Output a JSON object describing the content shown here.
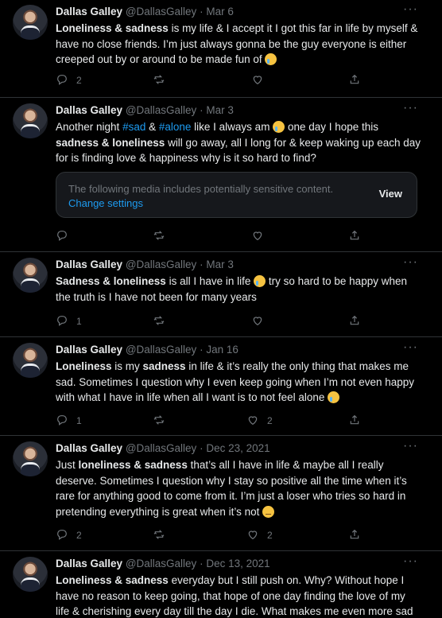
{
  "tweets": [
    {
      "name": "Dallas Galley",
      "handle": "@DallasGalley",
      "date": "Mar 6",
      "segments": [
        {
          "t": "Loneliness & sadness",
          "b": true
        },
        {
          "t": " is my life & I accept it I got this far in life by myself & have no close friends. I’m just always gonna be the guy everyone is either creeped out by or around to be made fun of "
        },
        {
          "emoji": "cry"
        }
      ],
      "replies": "2",
      "retweets": "",
      "likes": ""
    },
    {
      "name": "Dallas Galley",
      "handle": "@DallasGalley",
      "date": "Mar 3",
      "segments": [
        {
          "t": "Another night "
        },
        {
          "t": "#sad",
          "tag": true
        },
        {
          "t": " & "
        },
        {
          "t": "#alone",
          "tag": true
        },
        {
          "t": " like I always am "
        },
        {
          "emoji": "cry"
        },
        {
          "t": " one day I hope this "
        },
        {
          "t": "sadness & loneliness",
          "b": true
        },
        {
          "t": " will go away, all I long for & keep waking up each day for is finding love & happiness why is it so hard to find?"
        }
      ],
      "media_warning": {
        "text": "The following media includes potentially sensitive content.",
        "change_label": "Change settings",
        "view_label": "View"
      },
      "replies": "",
      "retweets": "",
      "likes": ""
    },
    {
      "name": "Dallas Galley",
      "handle": "@DallasGalley",
      "date": "Mar 3",
      "segments": [
        {
          "t": "Sadness & loneliness",
          "b": true
        },
        {
          "t": " is all I have in life "
        },
        {
          "emoji": "cry"
        },
        {
          "t": " try so hard to be happy when the truth is I have not been for many years"
        }
      ],
      "replies": "1",
      "retweets": "",
      "likes": ""
    },
    {
      "name": "Dallas Galley",
      "handle": "@DallasGalley",
      "date": "Jan 16",
      "segments": [
        {
          "t": "Loneliness",
          "b": true
        },
        {
          "t": " is my "
        },
        {
          "t": "sadness",
          "b": true
        },
        {
          "t": " in life & it’s really the only thing that makes me sad. Sometimes I question why I even keep going when I’m not even happy with what I have in life when all I want is to not feel alone "
        },
        {
          "emoji": "cry"
        }
      ],
      "replies": "1",
      "retweets": "",
      "likes": "2"
    },
    {
      "name": "Dallas Galley",
      "handle": "@DallasGalley",
      "date": "Dec 23, 2021",
      "segments": [
        {
          "t": "Just "
        },
        {
          "t": "loneliness & sadness",
          "b": true
        },
        {
          "t": " that’s all I have in life & maybe all I really deserve. Sometimes I question why I stay so positive all the time when it’s rare for anything good to come from it. I’m just a loser who tries so hard in pretending everything is great when it’s not "
        },
        {
          "emoji": "pensive"
        }
      ],
      "replies": "2",
      "retweets": "",
      "likes": "2"
    },
    {
      "name": "Dallas Galley",
      "handle": "@DallasGalley",
      "date": "Dec 13, 2021",
      "segments": [
        {
          "t": "Loneliness & sadness",
          "b": true
        },
        {
          "t": " everyday but I still push on. Why? Without hope I have no reason to keep going, that hope of one day finding the love of my life & cherishing every day till the day I die. What makes me even more sad"
        }
      ],
      "replies": "",
      "retweets": "",
      "likes": ""
    }
  ],
  "icons": {
    "reply": "reply-icon",
    "retweet": "retweet-icon",
    "like": "heart-icon",
    "share": "share-icon",
    "more": "more-dots-icon"
  },
  "colors": {
    "background": "#000000",
    "text": "#e7e9ea",
    "muted": "#71767b",
    "accent": "#1d9bf0",
    "divider": "#2f3336"
  },
  "more_label": "···"
}
